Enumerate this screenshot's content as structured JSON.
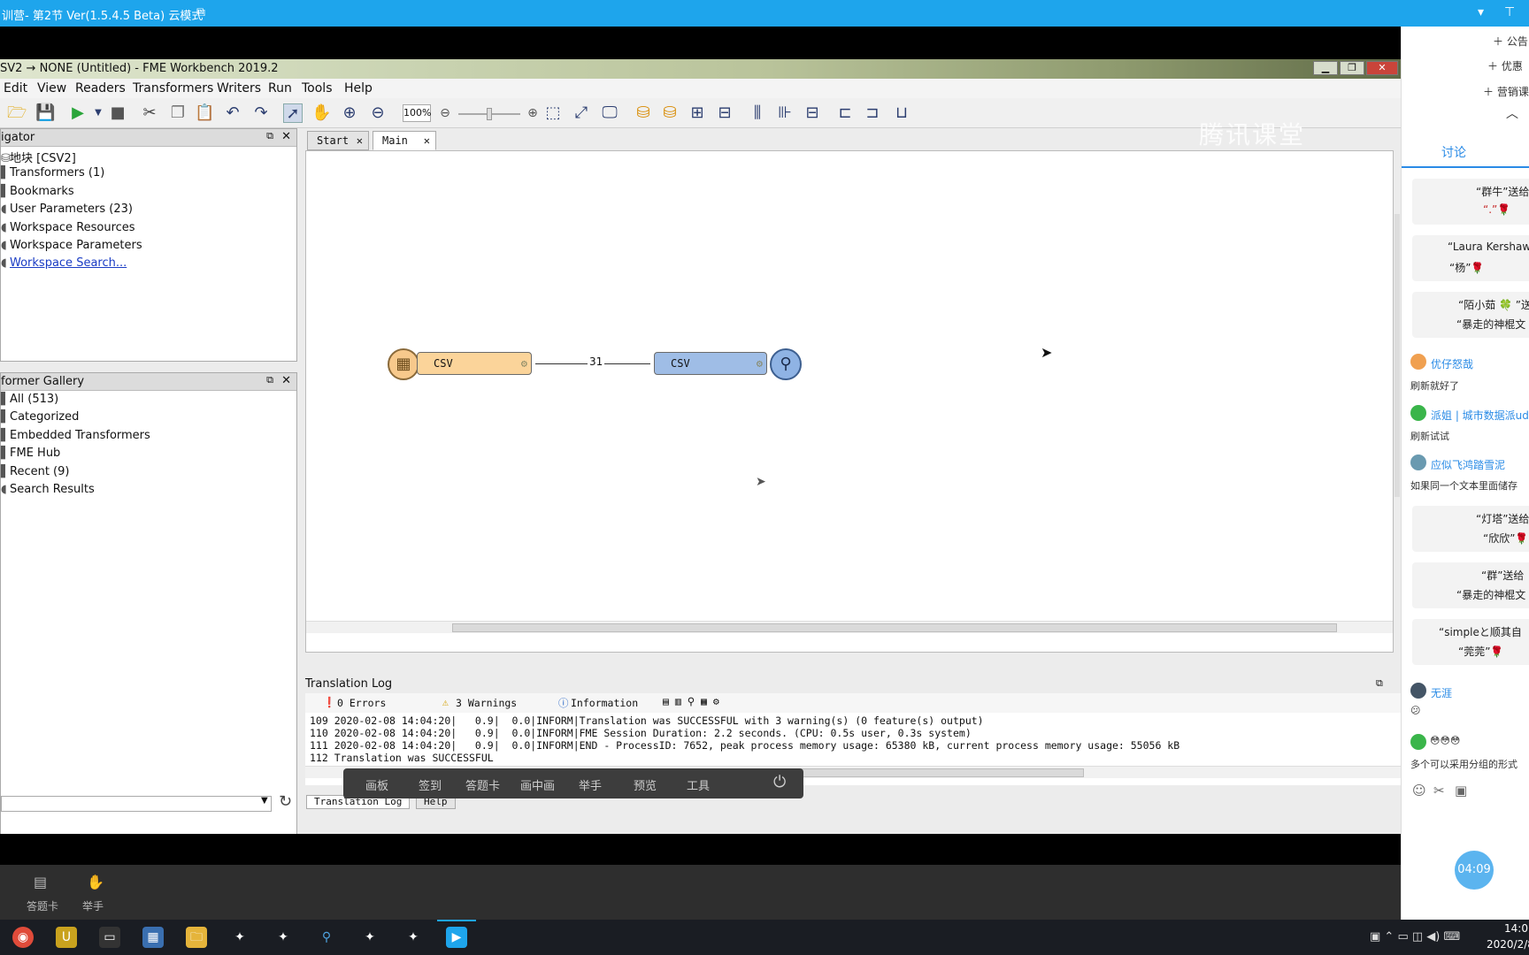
{
  "topbar": {
    "title": "训营- 第2节 Ver(1.5.4.5 Beta)  云模式"
  },
  "fme": {
    "title": "SV2 → NONE (Untitled) - FME Workbench 2019.2",
    "menu": [
      "Edit",
      "View",
      "Readers",
      "Transformers",
      "Writers",
      "Run",
      "Tools",
      "Help"
    ],
    "zoom": "100%",
    "watermark": "腾讯课堂",
    "navigator": {
      "title": "igator",
      "items": [
        "地块 [CSV2]",
        "Transformers (1)",
        "Bookmarks",
        "User Parameters (23)",
        "Workspace Resources",
        "Workspace Parameters",
        "Workspace Search..."
      ]
    },
    "gallery": {
      "title": "former Gallery",
      "items": [
        "All (513)",
        "Categorized",
        "Embedded Transformers",
        "FME Hub",
        "Recent (9)",
        "Search Results"
      ]
    },
    "tabs": [
      "Start",
      "Main"
    ],
    "canvas": {
      "reader_label": "CSV",
      "writer_label": "CSV",
      "link_count": "31"
    },
    "log": {
      "title": "Translation Log",
      "errors": "0 Errors",
      "warnings": "3 Warnings",
      "information": "Information",
      "lines": [
        "109 2020-02-08 14:04:20|   0.9|  0.0|INFORM|Translation was SUCCESSFUL with 3 warning(s) (0 feature(s) output)",
        "110 2020-02-08 14:04:20|   0.9|  0.0|INFORM|FME Session Duration: 2.2 seconds. (CPU: 0.5s user, 0.3s system)",
        "111 2020-02-08 14:04:20|   0.9|  0.0|INFORM|END - ProcessID: 7652, peak process memory usage: 65380 kB, current process memory usage: 55056 kB",
        "112 Translation was SUCCESSFUL"
      ],
      "bottom_tabs": [
        "Translation Log",
        "Help"
      ]
    }
  },
  "floatbar": [
    "画板",
    "签到",
    "答题卡",
    "画中画",
    "举手",
    "预览",
    "工具"
  ],
  "bottombar": [
    "答题卡",
    "举手"
  ],
  "chat": {
    "top_items": [
      "公告",
      "优惠",
      "营销课"
    ],
    "tab": "讨论",
    "messages": [
      {
        "type": "bubble",
        "l1": "“群牛”送给",
        "l2": "“.”🌹"
      },
      {
        "type": "bubble",
        "l1": "“Laura Kershaw",
        "l2": "“杨”🌹"
      },
      {
        "type": "bubble",
        "l1": "“陌小茹 🍀 ”送",
        "l2": "“暴走的神棍文"
      },
      {
        "type": "user",
        "name": "优仔怒哉",
        "text": "刷新就好了"
      },
      {
        "type": "user",
        "name": "派姐 | 城市数据派ud",
        "text": "刷新试试"
      },
      {
        "type": "user",
        "name": "应似飞鸿踏雪泥",
        "text": "如果同一个文本里面储存"
      },
      {
        "type": "bubble",
        "l1": "“灯塔”送给",
        "l2": "“欣欣”🌹"
      },
      {
        "type": "bubble",
        "l1": "“群”送给",
        "l2": "“暴走的神棍文"
      },
      {
        "type": "bubble",
        "l1": "“simpleと顺其自",
        "l2": "“莞莞”🌹"
      },
      {
        "type": "user",
        "name": "无涯",
        "text": "😕"
      },
      {
        "type": "user",
        "name": "",
        "text": "多个可以采用分组的形式"
      }
    ],
    "timer": "04:09"
  },
  "taskbar": {
    "time": "14:0",
    "date": "2020/2/8"
  }
}
